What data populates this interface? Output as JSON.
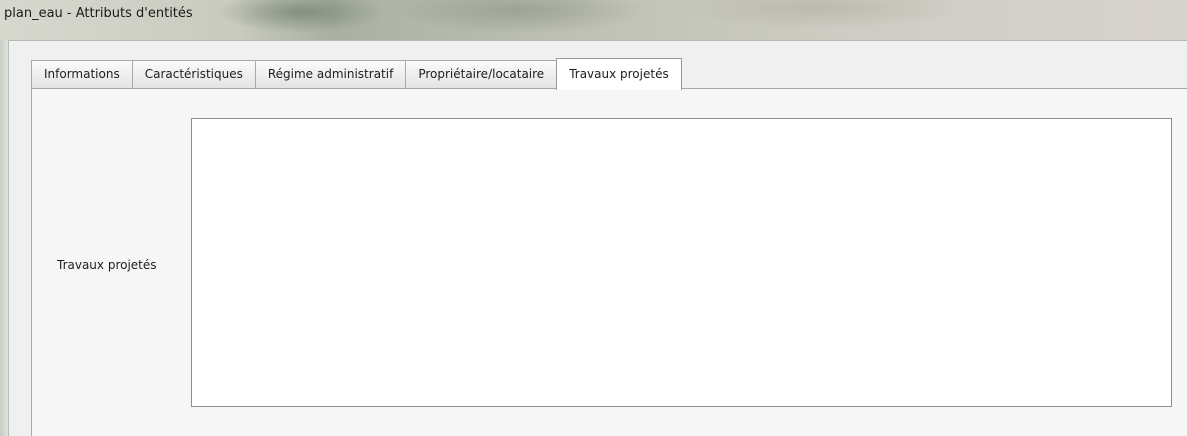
{
  "window": {
    "title": "plan_eau - Attributs d'entités"
  },
  "tabs": [
    {
      "label": "Informations",
      "active": false
    },
    {
      "label": "Caractéristiques",
      "active": false
    },
    {
      "label": "Régime administratif",
      "active": false
    },
    {
      "label": "Propriétaire/locataire",
      "active": false
    },
    {
      "label": "Travaux projetés",
      "active": true
    }
  ],
  "form": {
    "travaux_label": "Travaux projetés",
    "travaux_value": ""
  }
}
